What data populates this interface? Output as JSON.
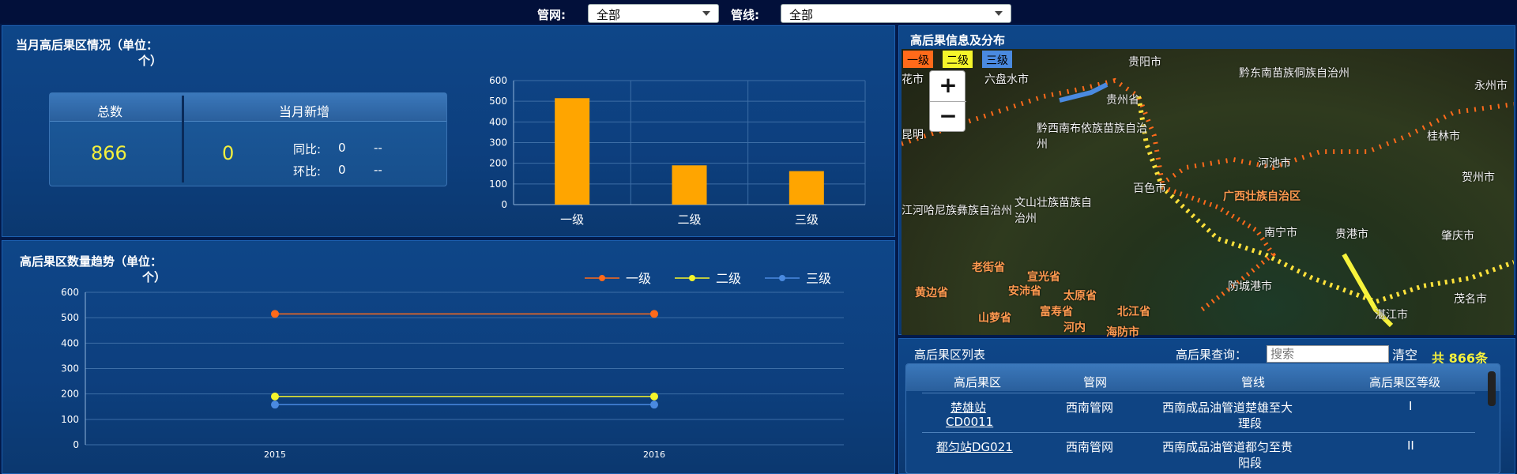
{
  "filters": {
    "pipenet_label": "管网:",
    "pipenet_value": "全部",
    "pipeline_label": "管线:",
    "pipeline_value": "全部"
  },
  "monthly": {
    "title_line1": "当月高后果区情况（单位：",
    "title_line2": "个）",
    "total_header": "总数",
    "new_header": "当月新增",
    "total_value": "866",
    "new_value": "0",
    "yoy_label": "同比:",
    "yoy_value": "0",
    "yoy_trend": "--",
    "mom_label": "环比:",
    "mom_value": "0",
    "mom_trend": "--"
  },
  "trend": {
    "title_line1": "高后果区数量趋势（单位：",
    "title_line2": "个）"
  },
  "map": {
    "title": "高后果信息及分布",
    "zoom_in": "+",
    "zoom_out": "−",
    "legend": [
      "一级",
      "二级",
      "三级"
    ],
    "labels": [
      "贵阳市",
      "黔东南苗族侗族自治州",
      "永州市",
      "花市",
      "六盘水市",
      "贵州省",
      "黔西南布依族苗族自治州",
      "桂林市",
      "昆明",
      "河池市",
      "贺州市",
      "百色市",
      "广西壮族自治区",
      "文山壮族苗族自治州",
      "江河哈尼族彝族自治州",
      "南宁市",
      "贵港市",
      "肇庆市",
      "老街省",
      "宣光省",
      "防城港市",
      "黄边省",
      "安沛省",
      "太原省",
      "北江省",
      "山萝省",
      "富寿省",
      "河内",
      "海防市",
      "湛江市",
      "茂名市"
    ]
  },
  "list": {
    "title": "高后果区列表",
    "query_label": "高后果查询：",
    "search_placeholder": "搜索",
    "clear_label": "清空",
    "count_text": "共 866条",
    "columns": [
      "高后果区",
      "管网",
      "管线",
      "高后果区等级"
    ],
    "rows": [
      {
        "area_line1": "楚雄站",
        "area_line2": "CD0011",
        "net": "西南管网",
        "line_1": "西南成品油管道楚雄至大",
        "line_2": "理段",
        "grade": "I"
      },
      {
        "area_line1": "都匀站DG021",
        "area_line2": "",
        "net": "西南管网",
        "line_1": "西南成品油管道都匀至贵",
        "line_2": "阳段",
        "grade": "II"
      }
    ]
  },
  "chart_data": [
    {
      "type": "bar",
      "categories": [
        "一级",
        "二级",
        "三级"
      ],
      "values": [
        515,
        190,
        162
      ],
      "ylim": [
        0,
        600
      ],
      "yticks": [
        0,
        100,
        200,
        300,
        400,
        500,
        600
      ],
      "colors": [
        "#ffa500"
      ],
      "grid": true
    },
    {
      "type": "line",
      "x": [
        "2015",
        "2016"
      ],
      "series": [
        {
          "name": "一级",
          "values": [
            515,
            515
          ],
          "color": "#ff6a1a"
        },
        {
          "name": "二级",
          "values": [
            190,
            190
          ],
          "color": "#f5f52a"
        },
        {
          "name": "三级",
          "values": [
            158,
            158
          ],
          "color": "#4a8ae0"
        }
      ],
      "ylim": [
        0,
        600
      ],
      "yticks": [
        0,
        100,
        200,
        300,
        400,
        500,
        600
      ],
      "legend": "top-right",
      "grid": true
    }
  ]
}
